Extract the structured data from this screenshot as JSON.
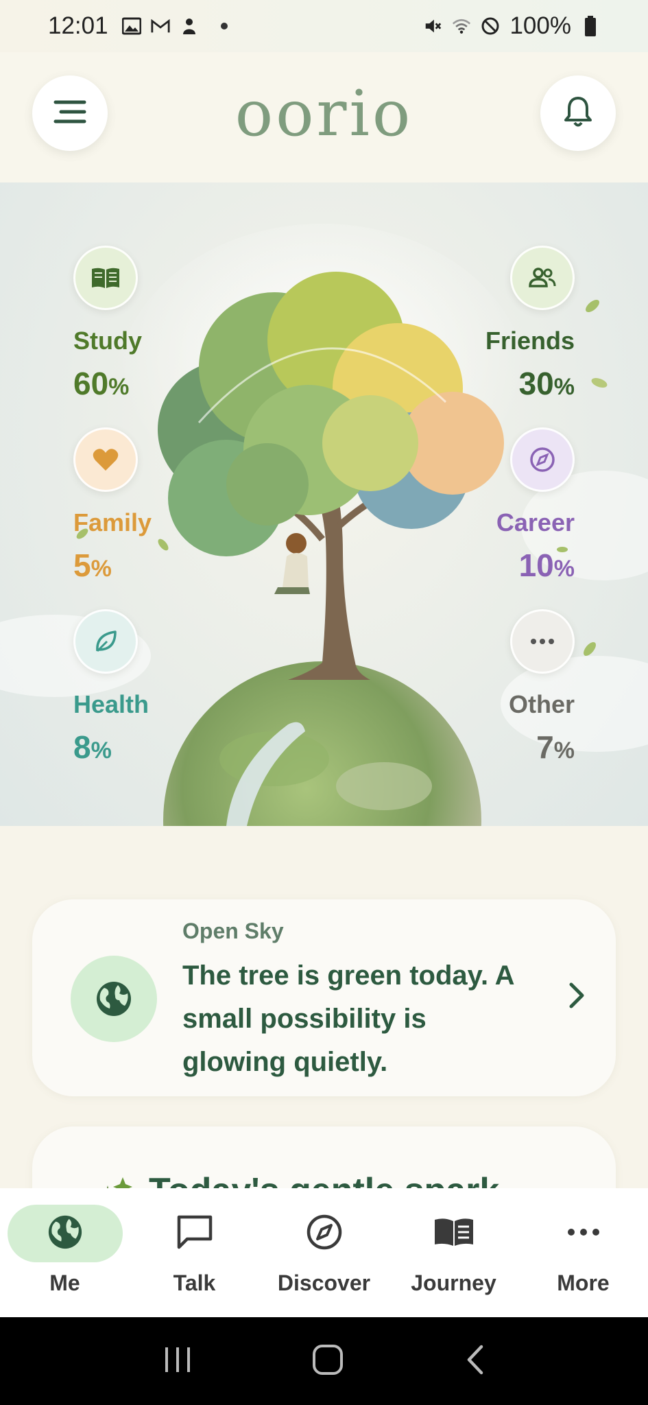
{
  "status_bar": {
    "time": "12:01",
    "battery": "100%"
  },
  "header": {
    "app_title": "oorio",
    "menu_icon": "menu-icon",
    "notification_icon": "bell-icon"
  },
  "categories": [
    {
      "label": "Study",
      "value": "60",
      "unit": "%",
      "icon": "book-icon",
      "color": "#4f7a2a",
      "icon_bg": "#e6f0d8"
    },
    {
      "label": "Friends",
      "value": "30",
      "unit": "%",
      "icon": "people-icon",
      "color": "#37612e",
      "icon_bg": "#e6f0d8"
    },
    {
      "label": "Family",
      "value": "5",
      "unit": "%",
      "icon": "heart-icon",
      "color": "#dc9a3a",
      "icon_bg": "#fbe9d3"
    },
    {
      "label": "Career",
      "value": "10",
      "unit": "%",
      "icon": "compass-icon",
      "color": "#8a62b4",
      "icon_bg": "#ece4f5"
    },
    {
      "label": "Health",
      "value": "8",
      "unit": "%",
      "icon": "leaf-icon",
      "color": "#3a9a8c",
      "icon_bg": "#e3f1ee"
    },
    {
      "label": "Other",
      "value": "7",
      "unit": "%",
      "icon": "more-icon",
      "color": "#6a6a64",
      "icon_bg": "#efeeea"
    }
  ],
  "card": {
    "kicker": "Open Sky",
    "text": "The tree is green today. A small possibility is glowing quietly.",
    "icon": "globe-icon"
  },
  "card2": {
    "title": "Today's gentle spark"
  },
  "bottom_nav": [
    {
      "label": "Me",
      "icon": "globe-icon",
      "active": true
    },
    {
      "label": "Talk",
      "icon": "chat-icon",
      "active": false
    },
    {
      "label": "Discover",
      "icon": "compass-icon",
      "active": false
    },
    {
      "label": "Journey",
      "icon": "open-book-icon",
      "active": false
    },
    {
      "label": "More",
      "icon": "more-icon",
      "active": false
    }
  ],
  "colors": {
    "accent": "#d4eed3",
    "brand_text": "#7f9c7e",
    "dark_green": "#2d5a40"
  }
}
